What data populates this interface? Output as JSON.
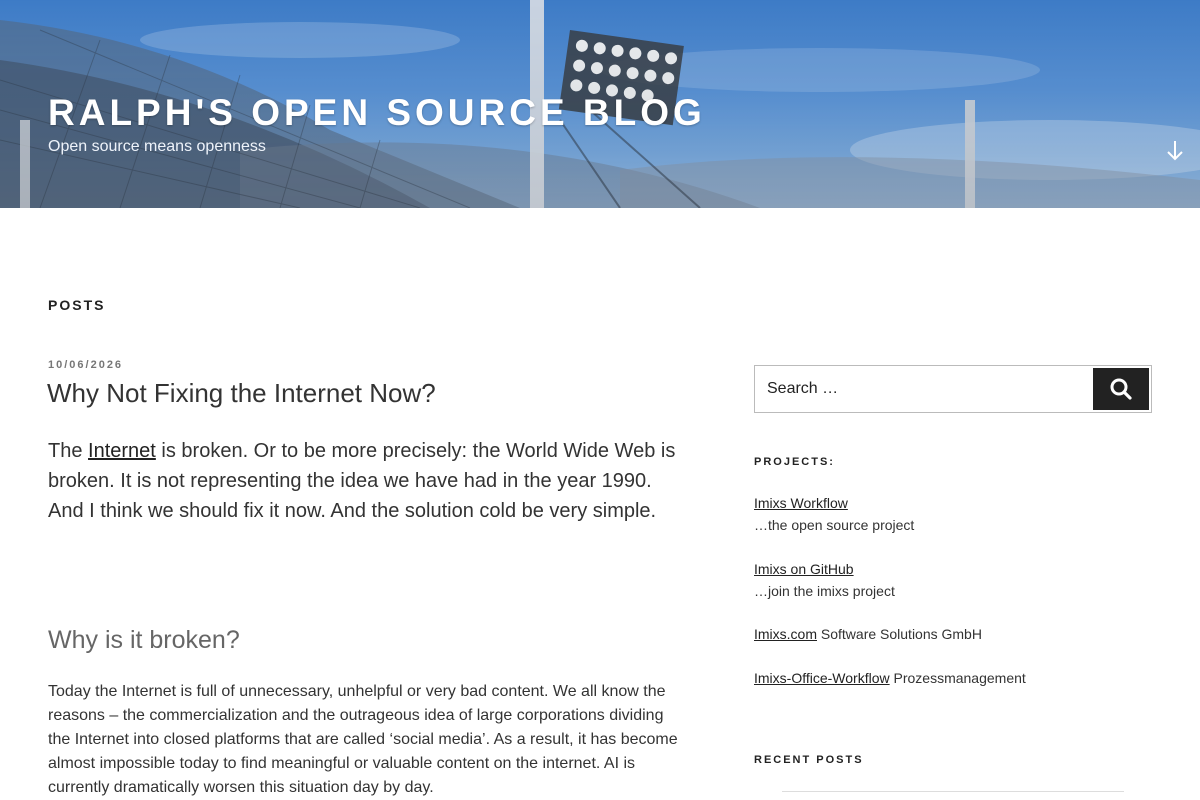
{
  "header": {
    "site_title": "RALPH'S OPEN SOURCE BLOG",
    "site_description": "Open source means openness",
    "scroll_icon": "arrow-down-icon"
  },
  "main": {
    "section_heading": "POSTS",
    "post": {
      "date": "10/06/2026",
      "title": "Why Not Fixing the Internet Now?",
      "lead_prefix": "The ",
      "lead_link": "Internet",
      "lead_suffix": " is broken. Or to be more precisely: the World Wide Web is broken. It is not representing the idea we have had in the year 1990. And I think we should fix it now. And the solution cold be very simple.",
      "subheading": "Why is it broken?",
      "body": "Today the Internet is full of unnecessary, unhelpful or very bad content. We all know the reasons – the commercialization and the outrageous idea of large corporations dividing the Internet into closed platforms that are called ‘social media’. As a result, it has become almost impossible today to find meaningful or valuable content on the internet. AI is currently dramatically worsen this situation day by day."
    }
  },
  "sidebar": {
    "search": {
      "placeholder": "Search …",
      "icon": "search-icon"
    },
    "projects": {
      "title": "PROJECTS:",
      "items": [
        {
          "link": "Imixs Workflow",
          "text": "…the open source project"
        },
        {
          "link": "Imixs on GitHub",
          "text": "…join the imixs project"
        },
        {
          "link": "Imixs.com",
          "text": " Software Solutions GmbH"
        },
        {
          "link": "Imixs-Office-Workflow",
          "text": " Prozessmanagement"
        }
      ]
    },
    "recent_posts": {
      "title": "RECENT POSTS"
    }
  }
}
